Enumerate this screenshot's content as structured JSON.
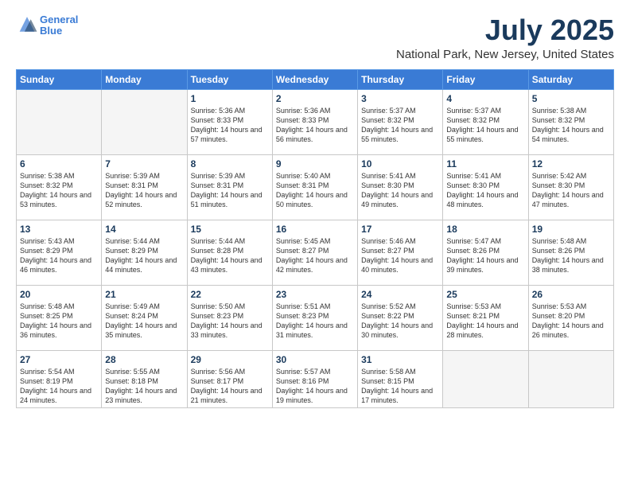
{
  "logo": {
    "line1": "General",
    "line2": "Blue"
  },
  "title": "July 2025",
  "subtitle": "National Park, New Jersey, United States",
  "weekdays": [
    "Sunday",
    "Monday",
    "Tuesday",
    "Wednesday",
    "Thursday",
    "Friday",
    "Saturday"
  ],
  "weeks": [
    [
      {
        "day": "",
        "info": ""
      },
      {
        "day": "",
        "info": ""
      },
      {
        "day": "1",
        "info": "Sunrise: 5:36 AM\nSunset: 8:33 PM\nDaylight: 14 hours and 57 minutes."
      },
      {
        "day": "2",
        "info": "Sunrise: 5:36 AM\nSunset: 8:33 PM\nDaylight: 14 hours and 56 minutes."
      },
      {
        "day": "3",
        "info": "Sunrise: 5:37 AM\nSunset: 8:32 PM\nDaylight: 14 hours and 55 minutes."
      },
      {
        "day": "4",
        "info": "Sunrise: 5:37 AM\nSunset: 8:32 PM\nDaylight: 14 hours and 55 minutes."
      },
      {
        "day": "5",
        "info": "Sunrise: 5:38 AM\nSunset: 8:32 PM\nDaylight: 14 hours and 54 minutes."
      }
    ],
    [
      {
        "day": "6",
        "info": "Sunrise: 5:38 AM\nSunset: 8:32 PM\nDaylight: 14 hours and 53 minutes."
      },
      {
        "day": "7",
        "info": "Sunrise: 5:39 AM\nSunset: 8:31 PM\nDaylight: 14 hours and 52 minutes."
      },
      {
        "day": "8",
        "info": "Sunrise: 5:39 AM\nSunset: 8:31 PM\nDaylight: 14 hours and 51 minutes."
      },
      {
        "day": "9",
        "info": "Sunrise: 5:40 AM\nSunset: 8:31 PM\nDaylight: 14 hours and 50 minutes."
      },
      {
        "day": "10",
        "info": "Sunrise: 5:41 AM\nSunset: 8:30 PM\nDaylight: 14 hours and 49 minutes."
      },
      {
        "day": "11",
        "info": "Sunrise: 5:41 AM\nSunset: 8:30 PM\nDaylight: 14 hours and 48 minutes."
      },
      {
        "day": "12",
        "info": "Sunrise: 5:42 AM\nSunset: 8:30 PM\nDaylight: 14 hours and 47 minutes."
      }
    ],
    [
      {
        "day": "13",
        "info": "Sunrise: 5:43 AM\nSunset: 8:29 PM\nDaylight: 14 hours and 46 minutes."
      },
      {
        "day": "14",
        "info": "Sunrise: 5:44 AM\nSunset: 8:29 PM\nDaylight: 14 hours and 44 minutes."
      },
      {
        "day": "15",
        "info": "Sunrise: 5:44 AM\nSunset: 8:28 PM\nDaylight: 14 hours and 43 minutes."
      },
      {
        "day": "16",
        "info": "Sunrise: 5:45 AM\nSunset: 8:27 PM\nDaylight: 14 hours and 42 minutes."
      },
      {
        "day": "17",
        "info": "Sunrise: 5:46 AM\nSunset: 8:27 PM\nDaylight: 14 hours and 40 minutes."
      },
      {
        "day": "18",
        "info": "Sunrise: 5:47 AM\nSunset: 8:26 PM\nDaylight: 14 hours and 39 minutes."
      },
      {
        "day": "19",
        "info": "Sunrise: 5:48 AM\nSunset: 8:26 PM\nDaylight: 14 hours and 38 minutes."
      }
    ],
    [
      {
        "day": "20",
        "info": "Sunrise: 5:48 AM\nSunset: 8:25 PM\nDaylight: 14 hours and 36 minutes."
      },
      {
        "day": "21",
        "info": "Sunrise: 5:49 AM\nSunset: 8:24 PM\nDaylight: 14 hours and 35 minutes."
      },
      {
        "day": "22",
        "info": "Sunrise: 5:50 AM\nSunset: 8:23 PM\nDaylight: 14 hours and 33 minutes."
      },
      {
        "day": "23",
        "info": "Sunrise: 5:51 AM\nSunset: 8:23 PM\nDaylight: 14 hours and 31 minutes."
      },
      {
        "day": "24",
        "info": "Sunrise: 5:52 AM\nSunset: 8:22 PM\nDaylight: 14 hours and 30 minutes."
      },
      {
        "day": "25",
        "info": "Sunrise: 5:53 AM\nSunset: 8:21 PM\nDaylight: 14 hours and 28 minutes."
      },
      {
        "day": "26",
        "info": "Sunrise: 5:53 AM\nSunset: 8:20 PM\nDaylight: 14 hours and 26 minutes."
      }
    ],
    [
      {
        "day": "27",
        "info": "Sunrise: 5:54 AM\nSunset: 8:19 PM\nDaylight: 14 hours and 24 minutes."
      },
      {
        "day": "28",
        "info": "Sunrise: 5:55 AM\nSunset: 8:18 PM\nDaylight: 14 hours and 23 minutes."
      },
      {
        "day": "29",
        "info": "Sunrise: 5:56 AM\nSunset: 8:17 PM\nDaylight: 14 hours and 21 minutes."
      },
      {
        "day": "30",
        "info": "Sunrise: 5:57 AM\nSunset: 8:16 PM\nDaylight: 14 hours and 19 minutes."
      },
      {
        "day": "31",
        "info": "Sunrise: 5:58 AM\nSunset: 8:15 PM\nDaylight: 14 hours and 17 minutes."
      },
      {
        "day": "",
        "info": ""
      },
      {
        "day": "",
        "info": ""
      }
    ]
  ]
}
